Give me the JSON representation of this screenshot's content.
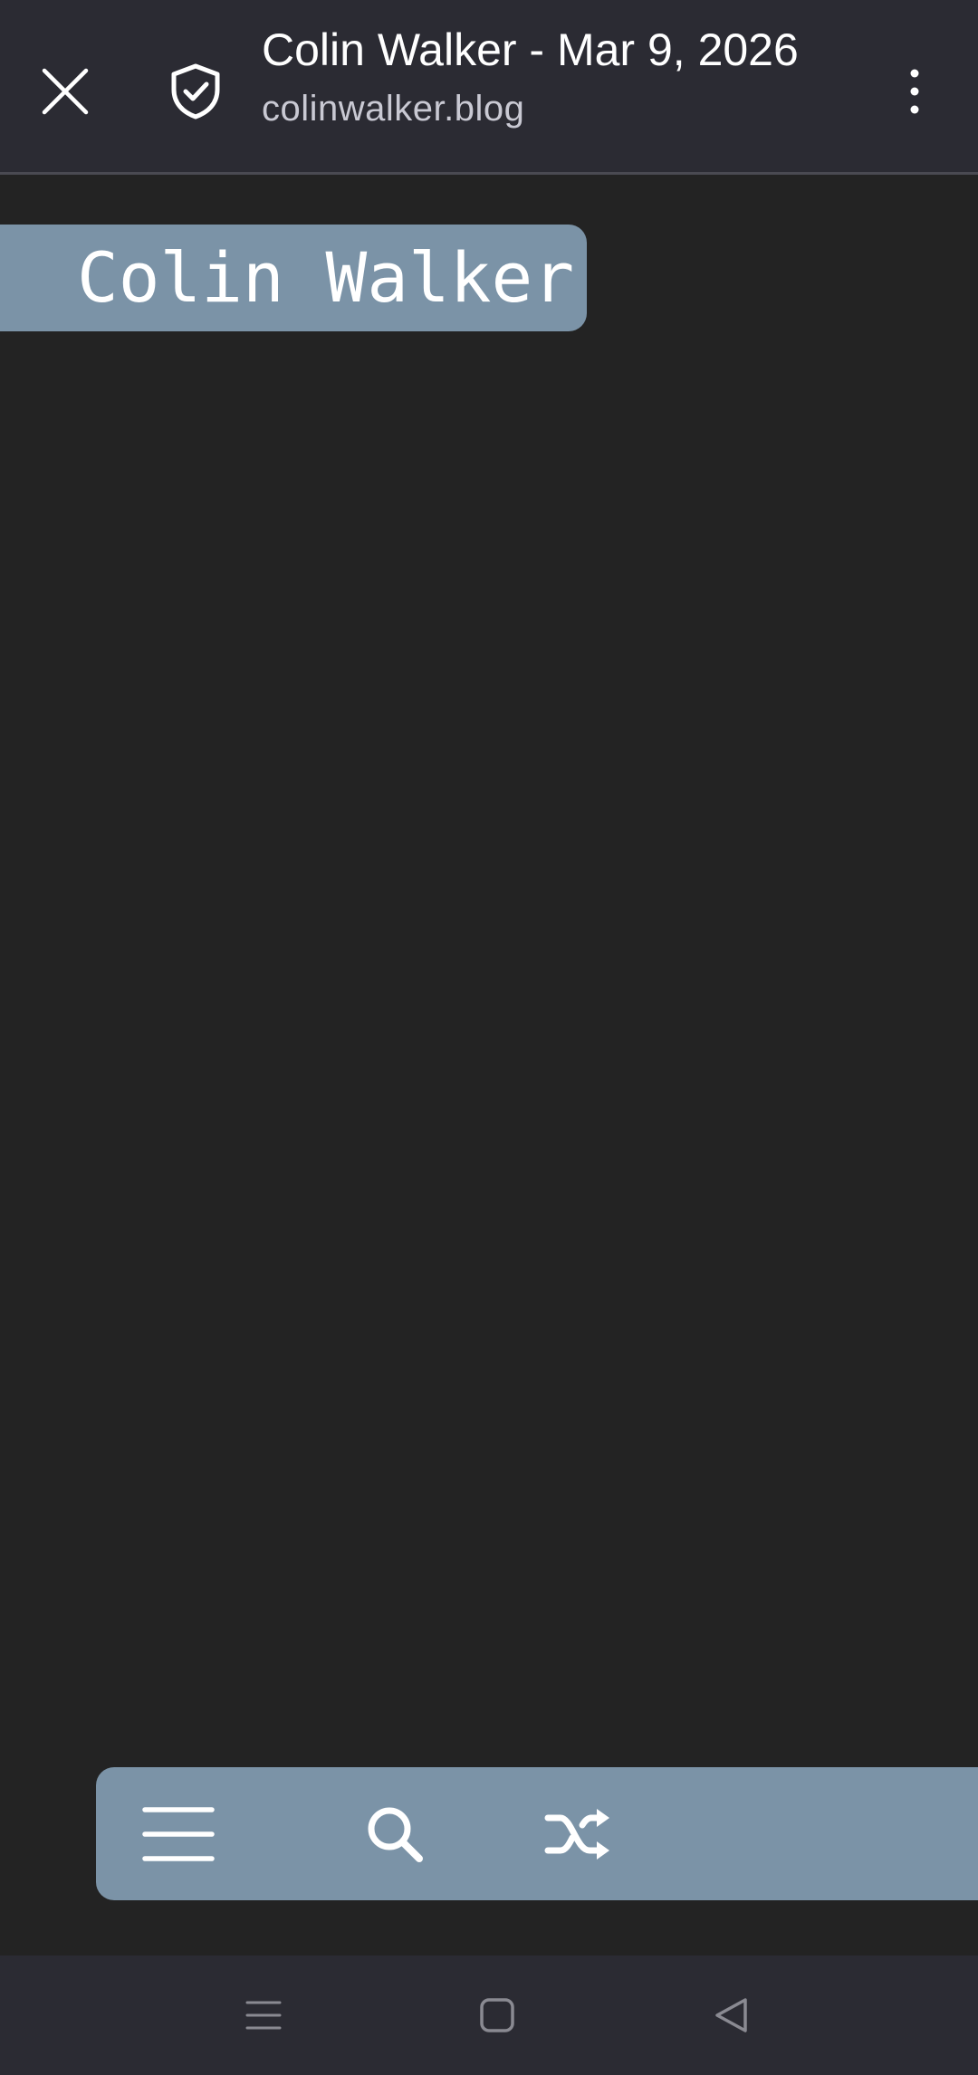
{
  "browser": {
    "page_title": "Colin Walker - Mar 9, 2026",
    "url": "colinwalker.blog",
    "icons": {
      "close": "close-icon",
      "security": "shield-check-icon",
      "menu": "more-vert-icon"
    }
  },
  "site": {
    "name": "Colin Walker",
    "accent_color": "#7b93a7",
    "background_color": "#232323"
  },
  "floating_nav": {
    "icons": [
      "hamburger-menu-icon",
      "search-icon",
      "shuffle-icon"
    ]
  },
  "system_nav": {
    "icons": [
      "recents-icon",
      "home-icon",
      "back-icon"
    ]
  }
}
